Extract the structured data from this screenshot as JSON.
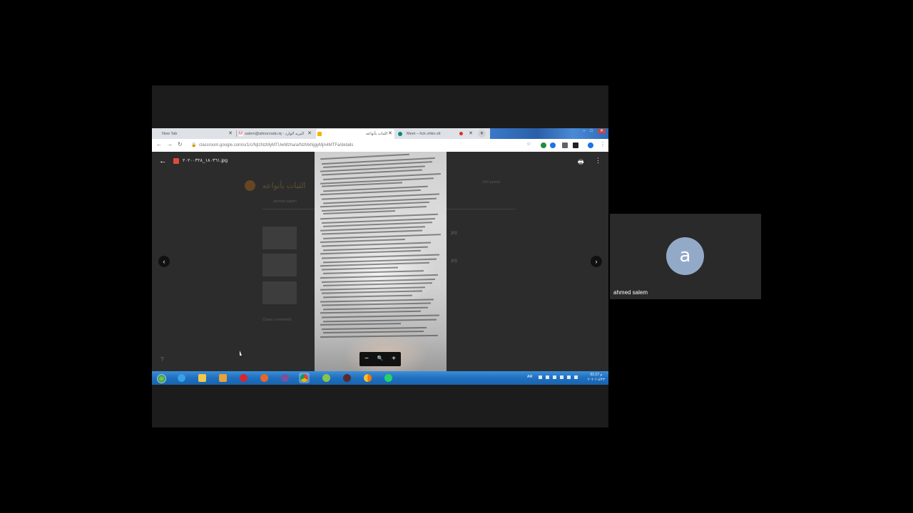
{
  "browser": {
    "tabs": [
      {
        "title": "New Tab",
        "favicon": "new-tab-icon",
        "active": false
      },
      {
        "title": "salem@almocradu.iq - البريد الوارد",
        "favicon": "gmail-icon",
        "active": false
      },
      {
        "title": "الثبات بأنواعه",
        "favicon": "classroom-icon",
        "active": true
      },
      {
        "title": "Meet – hck-zhkn-zit",
        "favicon": "meet-icon",
        "active": false
      }
    ],
    "new_tab_label": "+",
    "url": "classroom.google.com/u/1/c/NjIzNzMyMTUwMzha/a/NzMxNjgyMjA4MTFa/details",
    "window_controls": {
      "minimize": "–",
      "maximize": "□",
      "close": "✕"
    }
  },
  "viewer": {
    "back_label": "←",
    "filename": "١٨٠٣٦١_٢٠٢٠٠٣٢٨.jpg",
    "print_label": "🖶",
    "more_label": "⋮",
    "prev_label": "‹",
    "next_label": "›",
    "zoom_out_label": "−",
    "zoom_reset_label": "🔍",
    "zoom_in_label": "+",
    "help_label": "?"
  },
  "classroom_background": {
    "title": "الثبات بأنواعه",
    "author": "ahmed salem",
    "points": "100 points",
    "attachments": [
      ".jpg",
      ".jpg"
    ],
    "comments_label": "Class comments"
  },
  "taskbar": {
    "apps": [
      "start-orb",
      "internet-explorer",
      "file-explorer",
      "media-player",
      "opera",
      "firefox",
      "viber",
      "chrome",
      "app-green",
      "app-dark",
      "app-orange",
      "whatsapp"
    ],
    "language": "AR",
    "time": "01:17 م",
    "date": "٢٠٢٠/٠٤/٢٣"
  },
  "participant": {
    "initial": "a",
    "name": "ahmed salem",
    "avatar_color": "#93a9c8"
  }
}
